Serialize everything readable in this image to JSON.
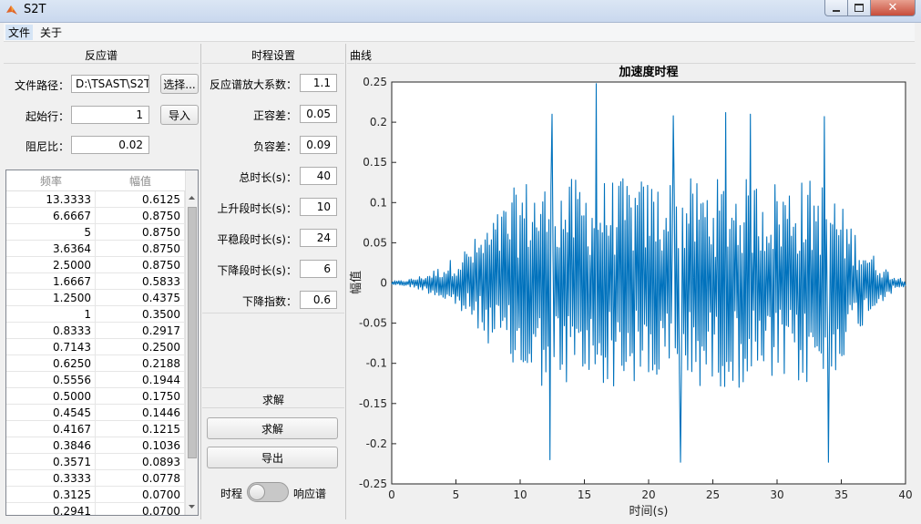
{
  "window": {
    "title": "S2T"
  },
  "menu": {
    "file": "文件",
    "about": "关于"
  },
  "response_panel": {
    "title": "反应谱",
    "file_path_label": "文件路径：",
    "file_path_value": "D:\\TSAST\\S2T",
    "browse_button": "选择...",
    "start_row_label": "起始行：",
    "start_row_value": "1",
    "import_button": "导入",
    "damping_label": "阻尼比：",
    "damping_value": "0.02",
    "table_headers": [
      "频率",
      "幅值"
    ],
    "rows": [
      [
        "13.3333",
        "0.6125"
      ],
      [
        "6.6667",
        "0.8750"
      ],
      [
        "5",
        "0.8750"
      ],
      [
        "3.6364",
        "0.8750"
      ],
      [
        "2.5000",
        "0.8750"
      ],
      [
        "1.6667",
        "0.5833"
      ],
      [
        "1.2500",
        "0.4375"
      ],
      [
        "1",
        "0.3500"
      ],
      [
        "0.8333",
        "0.2917"
      ],
      [
        "0.7143",
        "0.2500"
      ],
      [
        "0.6250",
        "0.2188"
      ],
      [
        "0.5556",
        "0.1944"
      ],
      [
        "0.5000",
        "0.1750"
      ],
      [
        "0.4545",
        "0.1446"
      ],
      [
        "0.4167",
        "0.1215"
      ],
      [
        "0.3846",
        "0.1036"
      ],
      [
        "0.3571",
        "0.0893"
      ],
      [
        "0.3333",
        "0.0778"
      ],
      [
        "0.3125",
        "0.0700"
      ],
      [
        "0.2941",
        "0.0700"
      ]
    ]
  },
  "time_panel": {
    "title": "时程设置",
    "fields": [
      {
        "label": "反应谱放大系数：",
        "value": "1.1"
      },
      {
        "label": "正容差：",
        "value": "0.05"
      },
      {
        "label": "负容差：",
        "value": "0.09"
      },
      {
        "label": "总时长(s)：",
        "value": "40"
      },
      {
        "label": "上升段时长(s)：",
        "value": "10"
      },
      {
        "label": "平稳段时长(s)：",
        "value": "24"
      },
      {
        "label": "下降段时长(s)：",
        "value": "6"
      },
      {
        "label": "下降指数：",
        "value": "0.6"
      }
    ],
    "solve_section_title": "求解",
    "solve_button": "求解",
    "export_button": "导出",
    "toggle_left_label": "时程",
    "toggle_right_label": "响应谱"
  },
  "curve_panel": {
    "title": "曲线"
  },
  "chart_data": {
    "type": "line",
    "title": "加速度时程",
    "xlabel": "时间(s)",
    "ylabel": "幅值",
    "xlim": [
      0,
      40
    ],
    "ylim": [
      -0.25,
      0.25
    ],
    "xticks": [
      0,
      5,
      10,
      15,
      20,
      25,
      30,
      35,
      40
    ],
    "yticks": [
      -0.25,
      -0.2,
      -0.15,
      -0.1,
      -0.05,
      0,
      0.05,
      0.1,
      0.15,
      0.2,
      0.25
    ],
    "ytick_labels": [
      "-0.25",
      "-0.2",
      "-0.15",
      "-0.1",
      "-0.05",
      "0",
      "0.05",
      "0.1",
      "0.15",
      "0.2",
      "0.25"
    ],
    "grid": false,
    "line_color": "#0072bd",
    "peaks": [
      [
        12.3,
        -0.22
      ],
      [
        12.5,
        0.21
      ],
      [
        15.9,
        0.248
      ],
      [
        22.5,
        -0.223
      ],
      [
        26.0,
        0.212
      ],
      [
        34.0,
        -0.223
      ],
      [
        33.7,
        0.207
      ],
      [
        27.9,
        0.21
      ],
      [
        21.9,
        0.208
      ]
    ]
  }
}
